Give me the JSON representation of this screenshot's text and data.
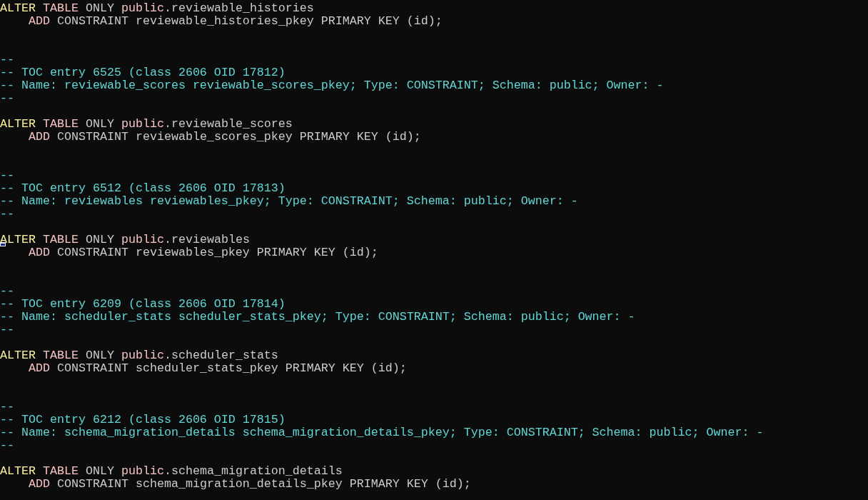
{
  "terminal": {
    "entries": [
      {
        "statement": [
          {
            "indented": false,
            "cursor": false,
            "segments": [
              {
                "text": "ALTER ",
                "kind": "verb"
              },
              {
                "text": "TABLE ",
                "kind": "keyword"
              },
              {
                "text": "ONLY ",
                "kind": "plain"
              },
              {
                "text": "public",
                "kind": "keyword"
              },
              {
                "text": ".reviewable_histories",
                "kind": "plain"
              }
            ]
          },
          {
            "indented": true,
            "cursor": false,
            "segments": [
              {
                "text": "ADD ",
                "kind": "keyword"
              },
              {
                "text": "CONSTRAINT reviewable_histories_pkey PRIMARY KEY (id);",
                "kind": "plain"
              }
            ]
          }
        ]
      },
      {
        "comment": [
          "--",
          "-- TOC entry 6525 (class 2606 OID 17812)",
          "-- Name: reviewable_scores reviewable_scores_pkey; Type: CONSTRAINT; Schema: public; Owner: -",
          "--"
        ],
        "statement": [
          {
            "indented": false,
            "cursor": false,
            "segments": [
              {
                "text": "ALTER ",
                "kind": "verb"
              },
              {
                "text": "TABLE ",
                "kind": "keyword"
              },
              {
                "text": "ONLY ",
                "kind": "plain"
              },
              {
                "text": "public",
                "kind": "keyword"
              },
              {
                "text": ".reviewable_scores",
                "kind": "plain"
              }
            ]
          },
          {
            "indented": true,
            "cursor": false,
            "segments": [
              {
                "text": "ADD ",
                "kind": "keyword"
              },
              {
                "text": "CONSTRAINT reviewable_scores_pkey PRIMARY KEY (id);",
                "kind": "plain"
              }
            ]
          }
        ]
      },
      {
        "comment": [
          "--",
          "-- TOC entry 6512 (class 2606 OID 17813)",
          "-- Name: reviewables reviewables_pkey; Type: CONSTRAINT; Schema: public; Owner: -",
          "--"
        ],
        "statement": [
          {
            "indented": false,
            "cursor": true,
            "segments": [
              {
                "text": "ALTER ",
                "kind": "verb"
              },
              {
                "text": "TABLE ",
                "kind": "keyword"
              },
              {
                "text": "ONLY ",
                "kind": "plain"
              },
              {
                "text": "public",
                "kind": "keyword"
              },
              {
                "text": ".reviewables",
                "kind": "plain"
              }
            ]
          },
          {
            "indented": true,
            "cursor": false,
            "segments": [
              {
                "text": "ADD ",
                "kind": "keyword"
              },
              {
                "text": "CONSTRAINT reviewables_pkey PRIMARY KEY (id);",
                "kind": "plain"
              }
            ]
          }
        ]
      },
      {
        "comment": [
          "--",
          "-- TOC entry 6209 (class 2606 OID 17814)",
          "-- Name: scheduler_stats scheduler_stats_pkey; Type: CONSTRAINT; Schema: public; Owner: -",
          "--"
        ],
        "statement": [
          {
            "indented": false,
            "cursor": false,
            "segments": [
              {
                "text": "ALTER ",
                "kind": "verb"
              },
              {
                "text": "TABLE ",
                "kind": "keyword"
              },
              {
                "text": "ONLY ",
                "kind": "plain"
              },
              {
                "text": "public",
                "kind": "keyword"
              },
              {
                "text": ".scheduler_stats",
                "kind": "plain"
              }
            ]
          },
          {
            "indented": true,
            "cursor": false,
            "segments": [
              {
                "text": "ADD ",
                "kind": "keyword"
              },
              {
                "text": "CONSTRAINT scheduler_stats_pkey PRIMARY KEY (id);",
                "kind": "plain"
              }
            ]
          }
        ]
      },
      {
        "comment": [
          "--",
          "-- TOC entry 6212 (class 2606 OID 17815)",
          "-- Name: schema_migration_details schema_migration_details_pkey; Type: CONSTRAINT; Schema: public; Owner: -",
          "--"
        ],
        "statement": [
          {
            "indented": false,
            "cursor": false,
            "segments": [
              {
                "text": "ALTER ",
                "kind": "verb"
              },
              {
                "text": "TABLE ",
                "kind": "keyword"
              },
              {
                "text": "ONLY ",
                "kind": "plain"
              },
              {
                "text": "public",
                "kind": "keyword"
              },
              {
                "text": ".schema_migration_details",
                "kind": "plain"
              }
            ]
          },
          {
            "indented": true,
            "cursor": false,
            "segments": [
              {
                "text": "ADD ",
                "kind": "keyword"
              },
              {
                "text": "CONSTRAINT schema_migration_details_pkey PRIMARY KEY (id);",
                "kind": "plain"
              }
            ]
          }
        ]
      }
    ]
  }
}
